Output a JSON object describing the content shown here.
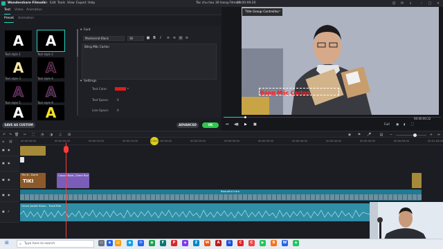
{
  "app": {
    "title": "Wondershare Filmora",
    "project_title": "Tác chu lieu 30 trong Filmora",
    "timecode": "00:00:09:20",
    "menu": [
      "File",
      "Edit",
      "Tools",
      "View",
      "Export",
      "Help"
    ]
  },
  "tabs": [
    "Text",
    "Video",
    "Animation"
  ],
  "subtabs": [
    "Preset",
    "Animation"
  ],
  "presets": [
    {
      "label": "Text style 1",
      "glyph": "A"
    },
    {
      "label": "Text style 2",
      "glyph": "A"
    },
    {
      "label": "Text style 3",
      "glyph": "A"
    },
    {
      "label": "Text style 4",
      "glyph": "A"
    },
    {
      "label": "Text style 5",
      "glyph": "A"
    },
    {
      "label": "Text style 6",
      "glyph": "A"
    },
    {
      "label": "",
      "glyph": "A"
    },
    {
      "label": "",
      "glyph": "A"
    }
  ],
  "editor": {
    "font_section": "Font",
    "font_name": "Montserrat Black",
    "font_size": "36",
    "bold": "B",
    "italic": "I",
    "text_content": "Bóng Mộc Carton",
    "settings_section": "Settings",
    "text_color_label": "Text Color:",
    "text_space_label": "Text Space:",
    "text_space_value": "0",
    "line_space_label": "Line Space:",
    "line_space_value": "0",
    "text_color": "#e11b1b"
  },
  "buttons": {
    "save_custom": "SAVE AS CUSTOM",
    "advanced": "ADVANCED",
    "ok": "OK"
  },
  "preview": {
    "title_group_controller": "Title Group Controller",
    "overlay_text": "Bóng Mộc Carton",
    "timecode": "00:00:00:22",
    "quality": "Full",
    "progress": 0.1
  },
  "timeline": {
    "cursor_label": "1:05:00",
    "ruler_ticks": [
      "00:00:00:00",
      "00:00:05:00",
      "00:00:10:00",
      "00:00:15:00",
      "00:00:20:00",
      "00:00:25:00",
      "00:00:30:00",
      "00:00:35:00",
      "00:00:40:00",
      "00:00:45:00",
      "00:00:50:00",
      "00:00:55:00",
      "00:01:00:00"
    ],
    "clips": {
      "title_clip": "Casual Bold | Steel Roll",
      "grid_clip": "Tiki 6 - Dorm",
      "audio_label": "Grace Jacket Blues - TrackTitle",
      "video_label": "Beautiful Intro"
    }
  },
  "taskbar": {
    "search_placeholder": "Type here to search"
  },
  "colors": {
    "accent": "#26d3c0",
    "playhead": "#ff3b3b",
    "overlay_text": "#ff1d1d",
    "ok_button": "#2ec84e",
    "audio": "#2f8fa6",
    "video": "#1f7a92"
  }
}
